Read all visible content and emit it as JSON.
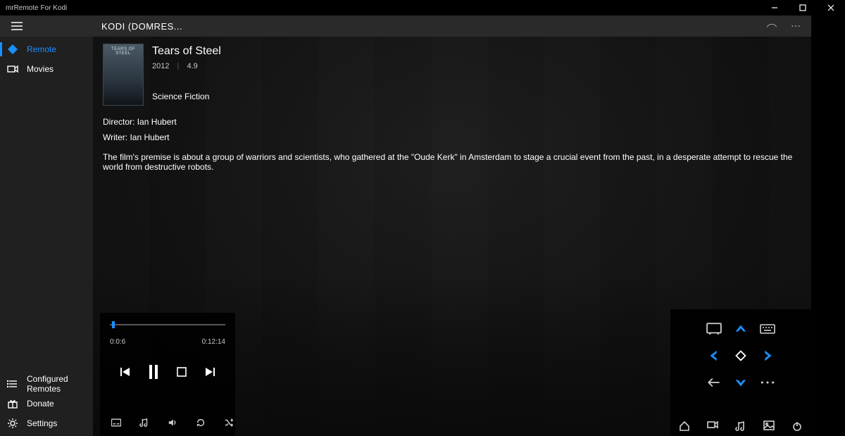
{
  "window": {
    "title": "mrRemote For Kodi"
  },
  "header": {
    "title": "KODI (DOMRES..."
  },
  "sidebar": {
    "top": [
      {
        "label": "Remote",
        "active": true,
        "icon": "kodi-icon"
      },
      {
        "label": "Movies",
        "active": false,
        "icon": "camera-icon"
      }
    ],
    "bottom": [
      {
        "label": "Configured Remotes",
        "icon": "list-icon"
      },
      {
        "label": "Donate",
        "icon": "gift-icon"
      },
      {
        "label": "Settings",
        "icon": "gear-icon"
      }
    ]
  },
  "movie": {
    "title": "Tears of Steel",
    "poster_text": "TEARS OF STEEL",
    "year": "2012",
    "rating": "4.9",
    "genre": "Science Fiction",
    "director_label": "Director:",
    "director": "Ian Hubert",
    "writer_label": "Writer:",
    "writer": "Ian Hubert",
    "plot": "The film's premise is about a group of warriors and scientists, who gathered at the \"Oude Kerk\" in Amsterdam to stage a crucial event from the past, in a desperate attempt to rescue the world from destructive robots."
  },
  "playback": {
    "elapsed": "0:0:6",
    "total": "0:12:14",
    "progress_pct": 2
  }
}
